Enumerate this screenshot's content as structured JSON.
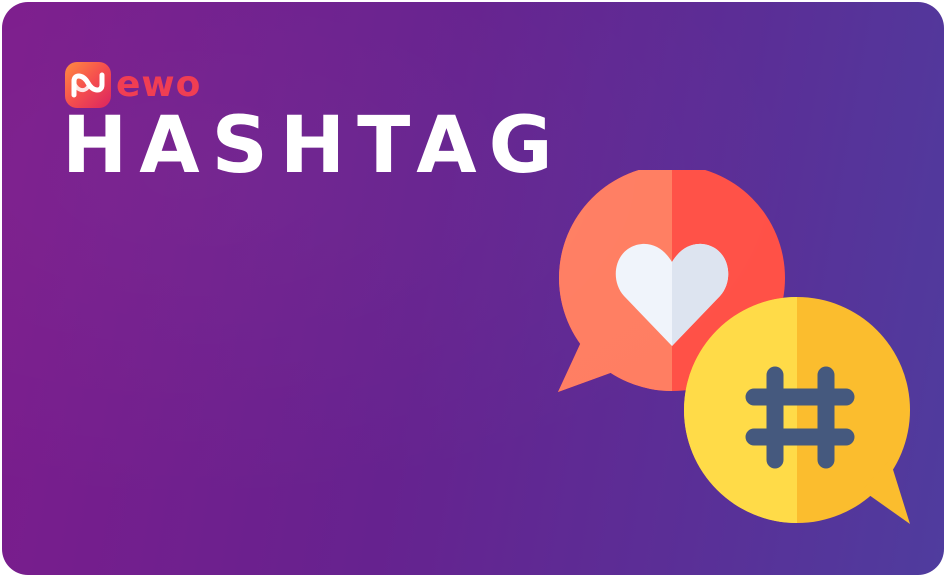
{
  "brand": {
    "name": "ewo",
    "accent_color": "#f0394f",
    "logo_icon": "infinity-loop-logo-icon"
  },
  "title": "HASHTAG",
  "illustration": {
    "heart_bubble_icon": "heart-speech-bubble-icon",
    "hashtag_bubble_icon": "hashtag-speech-bubble-icon",
    "colors": {
      "heart_bubble_light": "#ff7e62",
      "heart_bubble_dark": "#ff5147",
      "hashtag_bubble_light": "#ffdb48",
      "hashtag_bubble_dark": "#fbbd2e",
      "heart": "#f0f4fb",
      "hash_symbol": "#45597e"
    }
  },
  "background_gradient": [
    "#7d1c8c",
    "#4f3c9e"
  ]
}
